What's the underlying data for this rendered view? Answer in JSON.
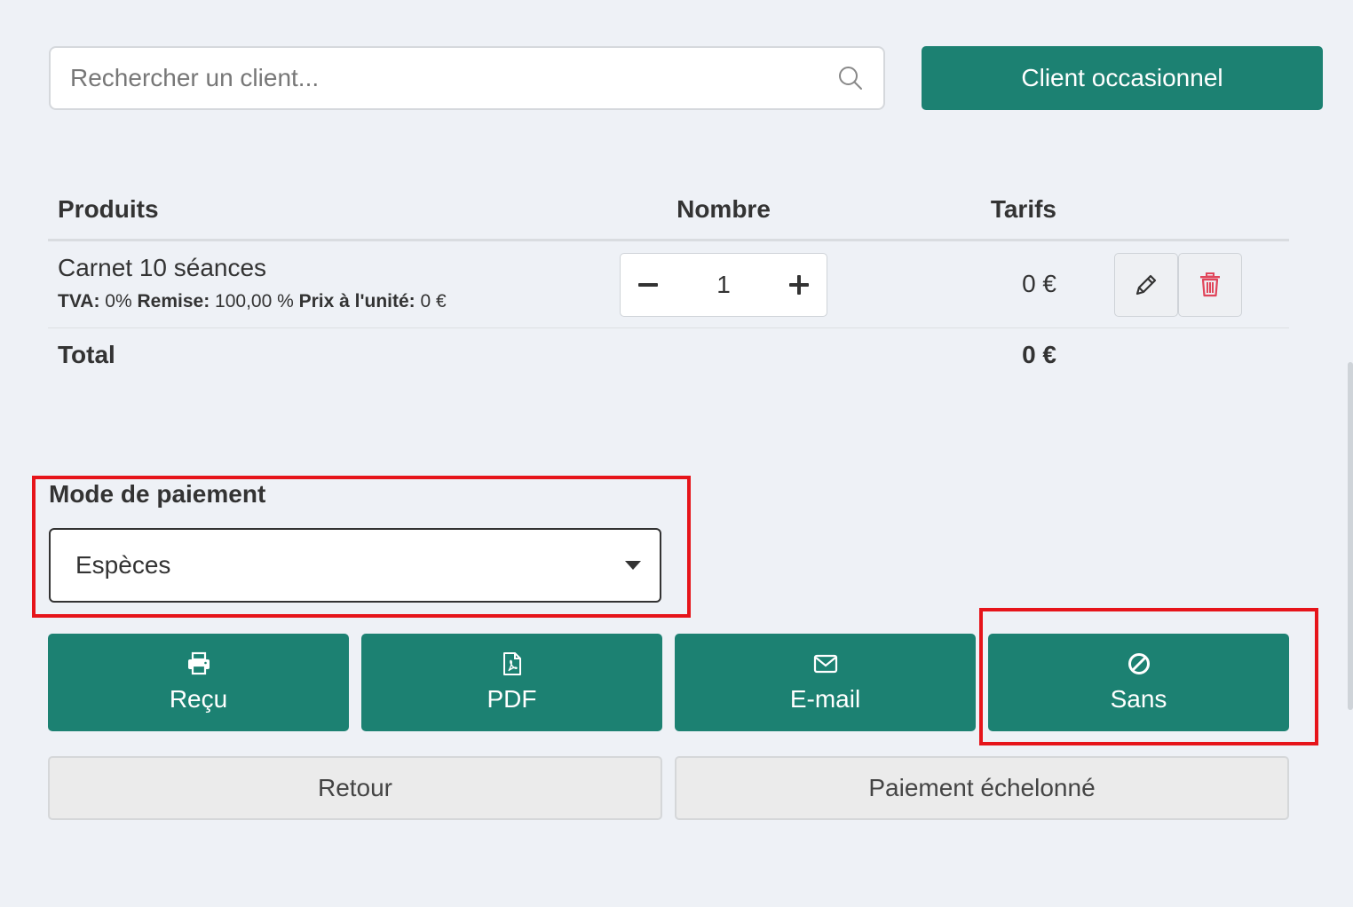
{
  "search": {
    "placeholder": "Rechercher un client..."
  },
  "occasional_button": {
    "label": "Client occasionnel"
  },
  "table": {
    "headers": {
      "products": "Produits",
      "quantity": "Nombre",
      "prices": "Tarifs"
    },
    "rows": [
      {
        "name": "Carnet 10 séances",
        "tva_label": "TVA:",
        "tva_value": "0%",
        "discount_label": "Remise:",
        "discount_value": "100,00 %",
        "unit_label": "Prix à l'unité:",
        "unit_value": "0 €",
        "quantity": "1",
        "price": "0 €"
      }
    ],
    "total_label": "Total",
    "total_value": "0 €"
  },
  "payment": {
    "label": "Mode de paiement",
    "selected": "Espèces"
  },
  "ticket_buttons": [
    {
      "label": "Reçu",
      "icon": "printer-icon"
    },
    {
      "label": "PDF",
      "icon": "file-pdf-icon"
    },
    {
      "label": "E-mail",
      "icon": "envelope-icon"
    },
    {
      "label": "Sans",
      "icon": "ban-icon"
    }
  ],
  "bottom_buttons": {
    "back": "Retour",
    "installments": "Paiement échelonné"
  },
  "colors": {
    "primary": "#1c8172",
    "highlight": "#e6141a",
    "delete": "#e0455a",
    "background": "#eef1f6"
  }
}
